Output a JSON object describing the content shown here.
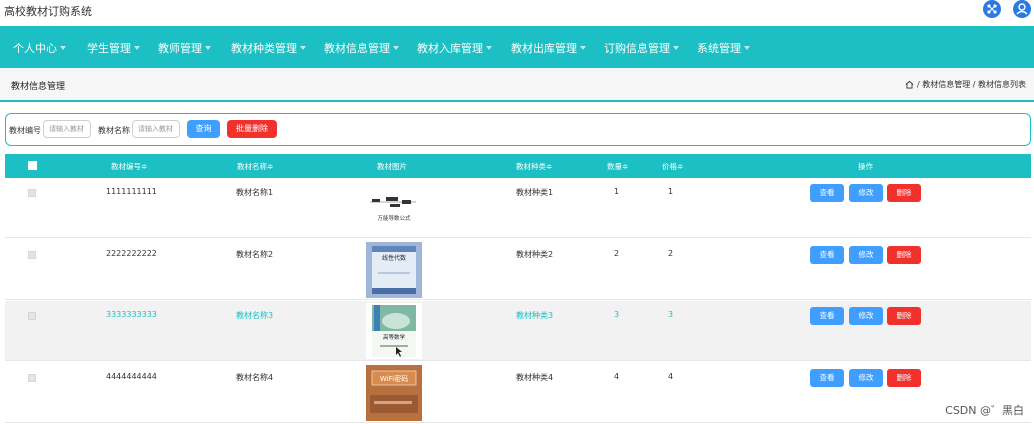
{
  "app": {
    "title": "高校教材订购系统"
  },
  "topbar": {
    "apps_icon": "apps-icon",
    "user_icon": "user-icon",
    "accent": "#2a7ae2"
  },
  "nav": {
    "color": "#1cc0c4",
    "items": [
      "个人中心",
      "学生管理",
      "教师管理",
      "教材种类管理",
      "教材信息管理",
      "教材入库管理",
      "教材出库管理",
      "订购信息管理",
      "系统管理"
    ]
  },
  "breadcrumb": {
    "title": "教材信息管理",
    "path": "/ 教材信息管理 / 教材信息列表"
  },
  "search": {
    "code_label": "教材编号",
    "code_placeholder": "请输入教材",
    "name_label": "教材名称",
    "name_placeholder": "请输入教材",
    "query_label": "查询",
    "batch_delete_label": "批量删除"
  },
  "table": {
    "headers": [
      "教材编号≑",
      "教材名称≑",
      "教材图片",
      "教材种类≑",
      "数量≑",
      "价格≑",
      "操作"
    ],
    "rows": [
      {
        "code": "1111111111",
        "name": "教材名称1",
        "type": "教材种类1",
        "qty": "1",
        "price": "1",
        "image_text": "万能导数公式"
      },
      {
        "code": "2222222222",
        "name": "教材名称2",
        "type": "教材种类2",
        "qty": "2",
        "price": "2",
        "image_text": "线性代数"
      },
      {
        "code": "3333333333",
        "name": "教材名称3",
        "type": "教材种类3",
        "qty": "3",
        "price": "3",
        "image_text": "高等数学"
      },
      {
        "code": "4444444444",
        "name": "教材名称4",
        "type": "教材种类4",
        "qty": "4",
        "price": "4",
        "image_text": "WiFi密码"
      }
    ],
    "actions": {
      "view": "查看",
      "edit": "修改",
      "delete": "删除"
    }
  },
  "watermark": "CSDN @゛黑白"
}
